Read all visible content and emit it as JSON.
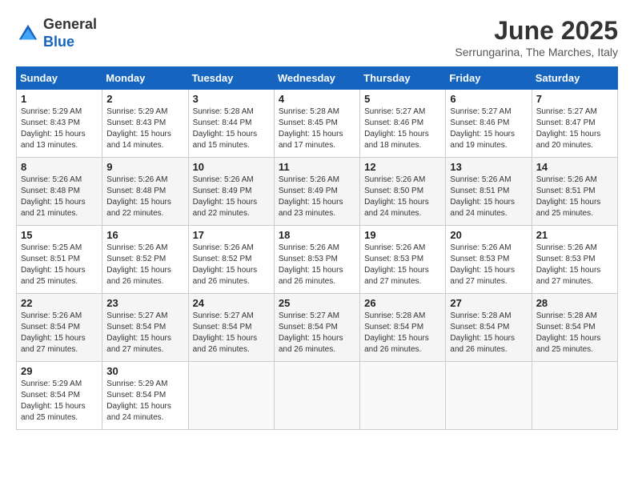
{
  "header": {
    "logo_general": "General",
    "logo_blue": "Blue",
    "month_year": "June 2025",
    "location": "Serrungarina, The Marches, Italy"
  },
  "calendar": {
    "days_of_week": [
      "Sunday",
      "Monday",
      "Tuesday",
      "Wednesday",
      "Thursday",
      "Friday",
      "Saturday"
    ],
    "weeks": [
      [
        {
          "day": "",
          "info": ""
        },
        {
          "day": "2",
          "info": "Sunrise: 5:29 AM\nSunset: 8:43 PM\nDaylight: 15 hours\nand 14 minutes."
        },
        {
          "day": "3",
          "info": "Sunrise: 5:28 AM\nSunset: 8:44 PM\nDaylight: 15 hours\nand 15 minutes."
        },
        {
          "day": "4",
          "info": "Sunrise: 5:28 AM\nSunset: 8:45 PM\nDaylight: 15 hours\nand 17 minutes."
        },
        {
          "day": "5",
          "info": "Sunrise: 5:27 AM\nSunset: 8:46 PM\nDaylight: 15 hours\nand 18 minutes."
        },
        {
          "day": "6",
          "info": "Sunrise: 5:27 AM\nSunset: 8:46 PM\nDaylight: 15 hours\nand 19 minutes."
        },
        {
          "day": "7",
          "info": "Sunrise: 5:27 AM\nSunset: 8:47 PM\nDaylight: 15 hours\nand 20 minutes."
        }
      ],
      [
        {
          "day": "1",
          "info": "Sunrise: 5:29 AM\nSunset: 8:43 PM\nDaylight: 15 hours\nand 13 minutes."
        },
        {
          "day": "9",
          "info": "Sunrise: 5:26 AM\nSunset: 8:48 PM\nDaylight: 15 hours\nand 22 minutes."
        },
        {
          "day": "10",
          "info": "Sunrise: 5:26 AM\nSunset: 8:49 PM\nDaylight: 15 hours\nand 22 minutes."
        },
        {
          "day": "11",
          "info": "Sunrise: 5:26 AM\nSunset: 8:49 PM\nDaylight: 15 hours\nand 23 minutes."
        },
        {
          "day": "12",
          "info": "Sunrise: 5:26 AM\nSunset: 8:50 PM\nDaylight: 15 hours\nand 24 minutes."
        },
        {
          "day": "13",
          "info": "Sunrise: 5:26 AM\nSunset: 8:51 PM\nDaylight: 15 hours\nand 24 minutes."
        },
        {
          "day": "14",
          "info": "Sunrise: 5:26 AM\nSunset: 8:51 PM\nDaylight: 15 hours\nand 25 minutes."
        }
      ],
      [
        {
          "day": "8",
          "info": "Sunrise: 5:26 AM\nSunset: 8:48 PM\nDaylight: 15 hours\nand 21 minutes."
        },
        {
          "day": "16",
          "info": "Sunrise: 5:26 AM\nSunset: 8:52 PM\nDaylight: 15 hours\nand 26 minutes."
        },
        {
          "day": "17",
          "info": "Sunrise: 5:26 AM\nSunset: 8:52 PM\nDaylight: 15 hours\nand 26 minutes."
        },
        {
          "day": "18",
          "info": "Sunrise: 5:26 AM\nSunset: 8:53 PM\nDaylight: 15 hours\nand 26 minutes."
        },
        {
          "day": "19",
          "info": "Sunrise: 5:26 AM\nSunset: 8:53 PM\nDaylight: 15 hours\nand 27 minutes."
        },
        {
          "day": "20",
          "info": "Sunrise: 5:26 AM\nSunset: 8:53 PM\nDaylight: 15 hours\nand 27 minutes."
        },
        {
          "day": "21",
          "info": "Sunrise: 5:26 AM\nSunset: 8:53 PM\nDaylight: 15 hours\nand 27 minutes."
        }
      ],
      [
        {
          "day": "15",
          "info": "Sunrise: 5:25 AM\nSunset: 8:51 PM\nDaylight: 15 hours\nand 25 minutes."
        },
        {
          "day": "23",
          "info": "Sunrise: 5:27 AM\nSunset: 8:54 PM\nDaylight: 15 hours\nand 27 minutes."
        },
        {
          "day": "24",
          "info": "Sunrise: 5:27 AM\nSunset: 8:54 PM\nDaylight: 15 hours\nand 26 minutes."
        },
        {
          "day": "25",
          "info": "Sunrise: 5:27 AM\nSunset: 8:54 PM\nDaylight: 15 hours\nand 26 minutes."
        },
        {
          "day": "26",
          "info": "Sunrise: 5:28 AM\nSunset: 8:54 PM\nDaylight: 15 hours\nand 26 minutes."
        },
        {
          "day": "27",
          "info": "Sunrise: 5:28 AM\nSunset: 8:54 PM\nDaylight: 15 hours\nand 26 minutes."
        },
        {
          "day": "28",
          "info": "Sunrise: 5:28 AM\nSunset: 8:54 PM\nDaylight: 15 hours\nand 25 minutes."
        }
      ],
      [
        {
          "day": "22",
          "info": "Sunrise: 5:26 AM\nSunset: 8:54 PM\nDaylight: 15 hours\nand 27 minutes."
        },
        {
          "day": "30",
          "info": "Sunrise: 5:29 AM\nSunset: 8:54 PM\nDaylight: 15 hours\nand 24 minutes."
        },
        {
          "day": "",
          "info": ""
        },
        {
          "day": "",
          "info": ""
        },
        {
          "day": "",
          "info": ""
        },
        {
          "day": "",
          "info": ""
        },
        {
          "day": ""
        }
      ],
      [
        {
          "day": "29",
          "info": "Sunrise: 5:29 AM\nSunset: 8:54 PM\nDaylight: 15 hours\nand 25 minutes."
        },
        {
          "day": "",
          "info": ""
        },
        {
          "day": "",
          "info": ""
        },
        {
          "day": "",
          "info": ""
        },
        {
          "day": "",
          "info": ""
        },
        {
          "day": "",
          "info": ""
        },
        {
          "day": "",
          "info": ""
        }
      ]
    ]
  }
}
